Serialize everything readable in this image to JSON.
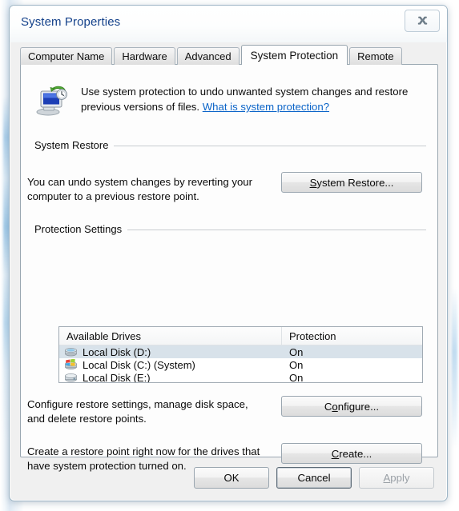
{
  "window": {
    "title": "System Properties",
    "close_icon": "close-x-icon"
  },
  "tabs": [
    {
      "label": "Computer Name",
      "selected": false
    },
    {
      "label": "Hardware",
      "selected": false
    },
    {
      "label": "Advanced",
      "selected": false
    },
    {
      "label": "System Protection",
      "selected": true
    },
    {
      "label": "Remote",
      "selected": false
    }
  ],
  "intro": {
    "icon": "system-protection-computer-icon",
    "text": "Use system protection to undo unwanted system changes and restore previous versions of files.",
    "link_label": "What is system protection?"
  },
  "system_restore": {
    "group_title": "System Restore",
    "description": "You can undo system changes by reverting your computer to a previous restore point.",
    "button_label": "System Restore...",
    "button_accel": "S"
  },
  "protection_settings": {
    "group_title": "Protection Settings",
    "columns": {
      "drives": "Available Drives",
      "protection": "Protection"
    },
    "rows": [
      {
        "icon": "hard-disk-icon",
        "name": "Local Disk (D:)",
        "protection": "On",
        "selected": true
      },
      {
        "icon": "system-disk-windows-icon",
        "name": "Local Disk (C:) (System)",
        "protection": "On",
        "selected": false
      },
      {
        "icon": "hard-disk-icon",
        "name": "Local Disk (E:)",
        "protection": "On",
        "selected": false
      }
    ],
    "configure": {
      "description": "Configure restore settings, manage disk space, and delete restore points.",
      "button_label": "Configure...",
      "button_accel": "o"
    },
    "create": {
      "description": "Create a restore point right now for the drives that have system protection turned on.",
      "button_label": "Create...",
      "button_accel": "C"
    }
  },
  "footer": {
    "ok_label": "OK",
    "cancel_label": "Cancel",
    "apply_label": "Apply",
    "apply_accel": "A",
    "apply_disabled": true
  },
  "colors": {
    "link": "#0b64c8",
    "title_text": "#15428b",
    "selection": "#d8e2ea",
    "dialog_face": "#f0f0f0",
    "page_face": "#fdfdfd"
  }
}
